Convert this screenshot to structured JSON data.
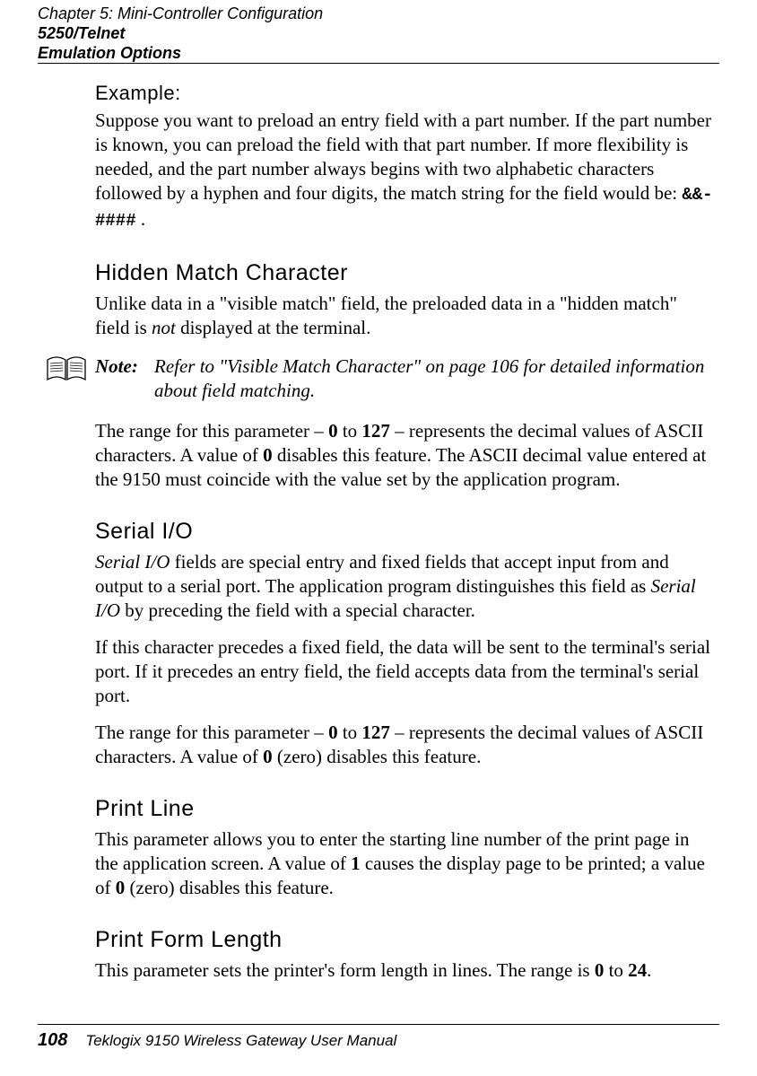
{
  "header": {
    "chapter": "Chapter 5:  Mini-Controller Configuration",
    "section1": "5250/Telnet",
    "section2": "Emulation Options"
  },
  "example": {
    "heading": "Example:",
    "body_pre": "Suppose you want to preload an entry field with a part number. If the part number is known, you can preload the field with that part number. If more flexibility is needed, and the part number always begins with two alphabetic characters followed by a hyphen and four digits, the match string for the field would be: ",
    "code": "&&-####",
    "body_post": " ."
  },
  "hidden": {
    "heading": "Hidden Match Character",
    "p1a": "Unlike data in a \"visible match\" field, the preloaded data in a \"hidden match\" field is ",
    "p1_em": "not",
    "p1b": " displayed at the terminal.",
    "note_label": "Note:",
    "note_line1": "Refer to \"Visible Match Character\" on page 106 for detailed information",
    "note_line2": "about field matching.",
    "p2a": "The range for this parameter – ",
    "p2b": " to ",
    "p2c": " – represents the decimal values of ASCII characters. A value of ",
    "p2d": " disables this feature. The ASCII decimal value entered at the 9150 must coincide with the value set by the application program.",
    "v0a": "0",
    "v127": "127",
    "v0b": "0"
  },
  "serial": {
    "heading": "Serial I/O",
    "p1a_em": "Serial I/O",
    "p1a": " fields are special entry and fixed fields that accept input from and output to a serial port. The application program distinguishes this field as ",
    "p1b_em": "Serial I/O",
    "p1b": " by preceding the field with a special character.",
    "p2": "If this character precedes a fixed field, the data will be sent to the terminal's serial port. If it precedes an entry field, the field accepts data from the terminal's serial port.",
    "p3a": "The range for this parameter – ",
    "p3b": " to ",
    "p3c": " – represents the decimal values of ASCII characters. A value of ",
    "p3d": " (zero) disables this feature.",
    "v0a": "0",
    "v127": "127",
    "v0b": "0"
  },
  "printline": {
    "heading": "Print Line",
    "p1a": "This parameter allows you to enter the starting line number of the print page in the application screen. A value of ",
    "v1": "1",
    "p1b": " causes the display page to be printed; a value of ",
    "v0": "0",
    "p1c": " (zero) disables this feature."
  },
  "printform": {
    "heading": "Print Form Length",
    "p1a": "This parameter sets the printer's form length in lines. The range is ",
    "v0": "0",
    "p1b": " to ",
    "v24": "24",
    "p1c": "."
  },
  "footer": {
    "page": "108",
    "title": "Teklogix 9150 Wireless Gateway User Manual"
  }
}
